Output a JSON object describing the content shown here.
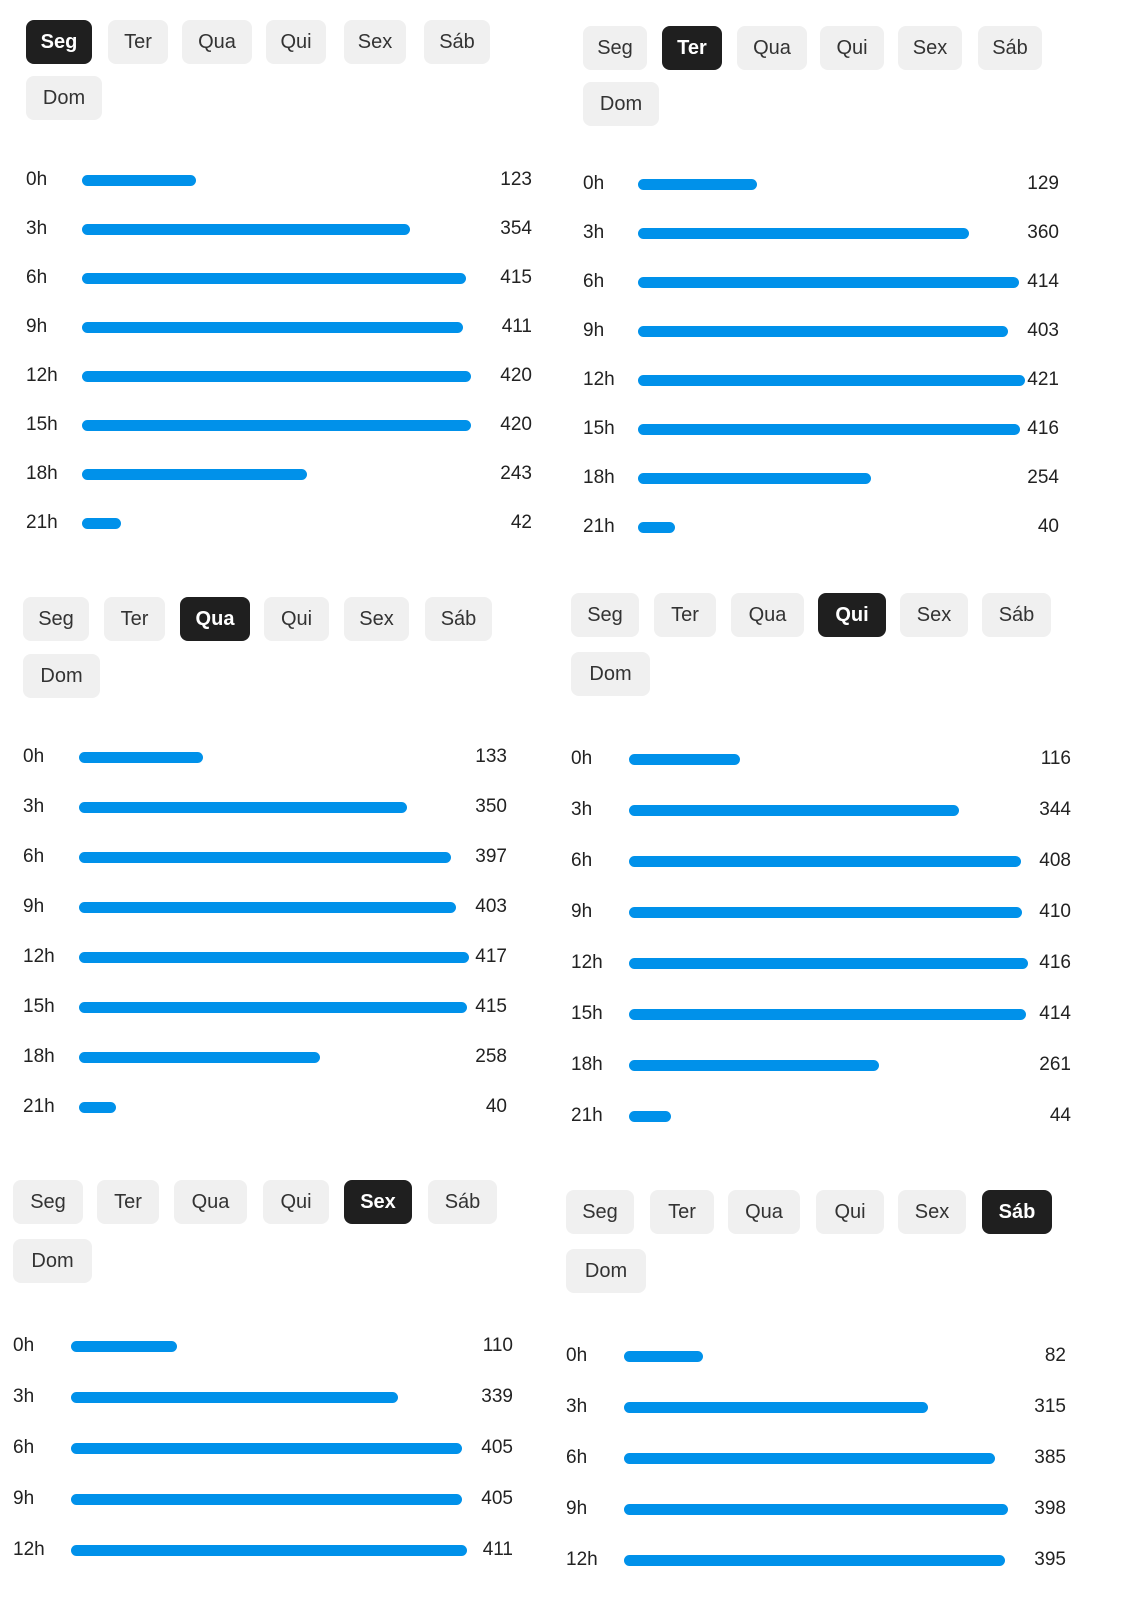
{
  "days": [
    "Seg",
    "Ter",
    "Qua",
    "Qui",
    "Sex",
    "Sáb",
    "Dom"
  ],
  "hours": [
    "0h",
    "3h",
    "6h",
    "9h",
    "12h",
    "15h",
    "18h",
    "21h"
  ],
  "colors": {
    "bar": "#0091ea",
    "active_tab": "#1f1f1f",
    "tab": "#f0f0f0"
  },
  "panels": [
    {
      "selected": "Seg",
      "values": [
        123,
        354,
        415,
        411,
        420,
        420,
        243,
        42
      ]
    },
    {
      "selected": "Ter",
      "values": [
        129,
        360,
        414,
        403,
        421,
        416,
        254,
        40
      ]
    },
    {
      "selected": "Qua",
      "values": [
        133,
        350,
        397,
        403,
        417,
        415,
        258,
        40
      ]
    },
    {
      "selected": "Qui",
      "values": [
        116,
        344,
        408,
        410,
        416,
        414,
        261,
        44
      ]
    },
    {
      "selected": "Sex",
      "values": [
        110,
        339,
        405,
        405,
        411
      ]
    },
    {
      "selected": "Sáb",
      "values": [
        82,
        315,
        385,
        398,
        395
      ]
    }
  ]
}
